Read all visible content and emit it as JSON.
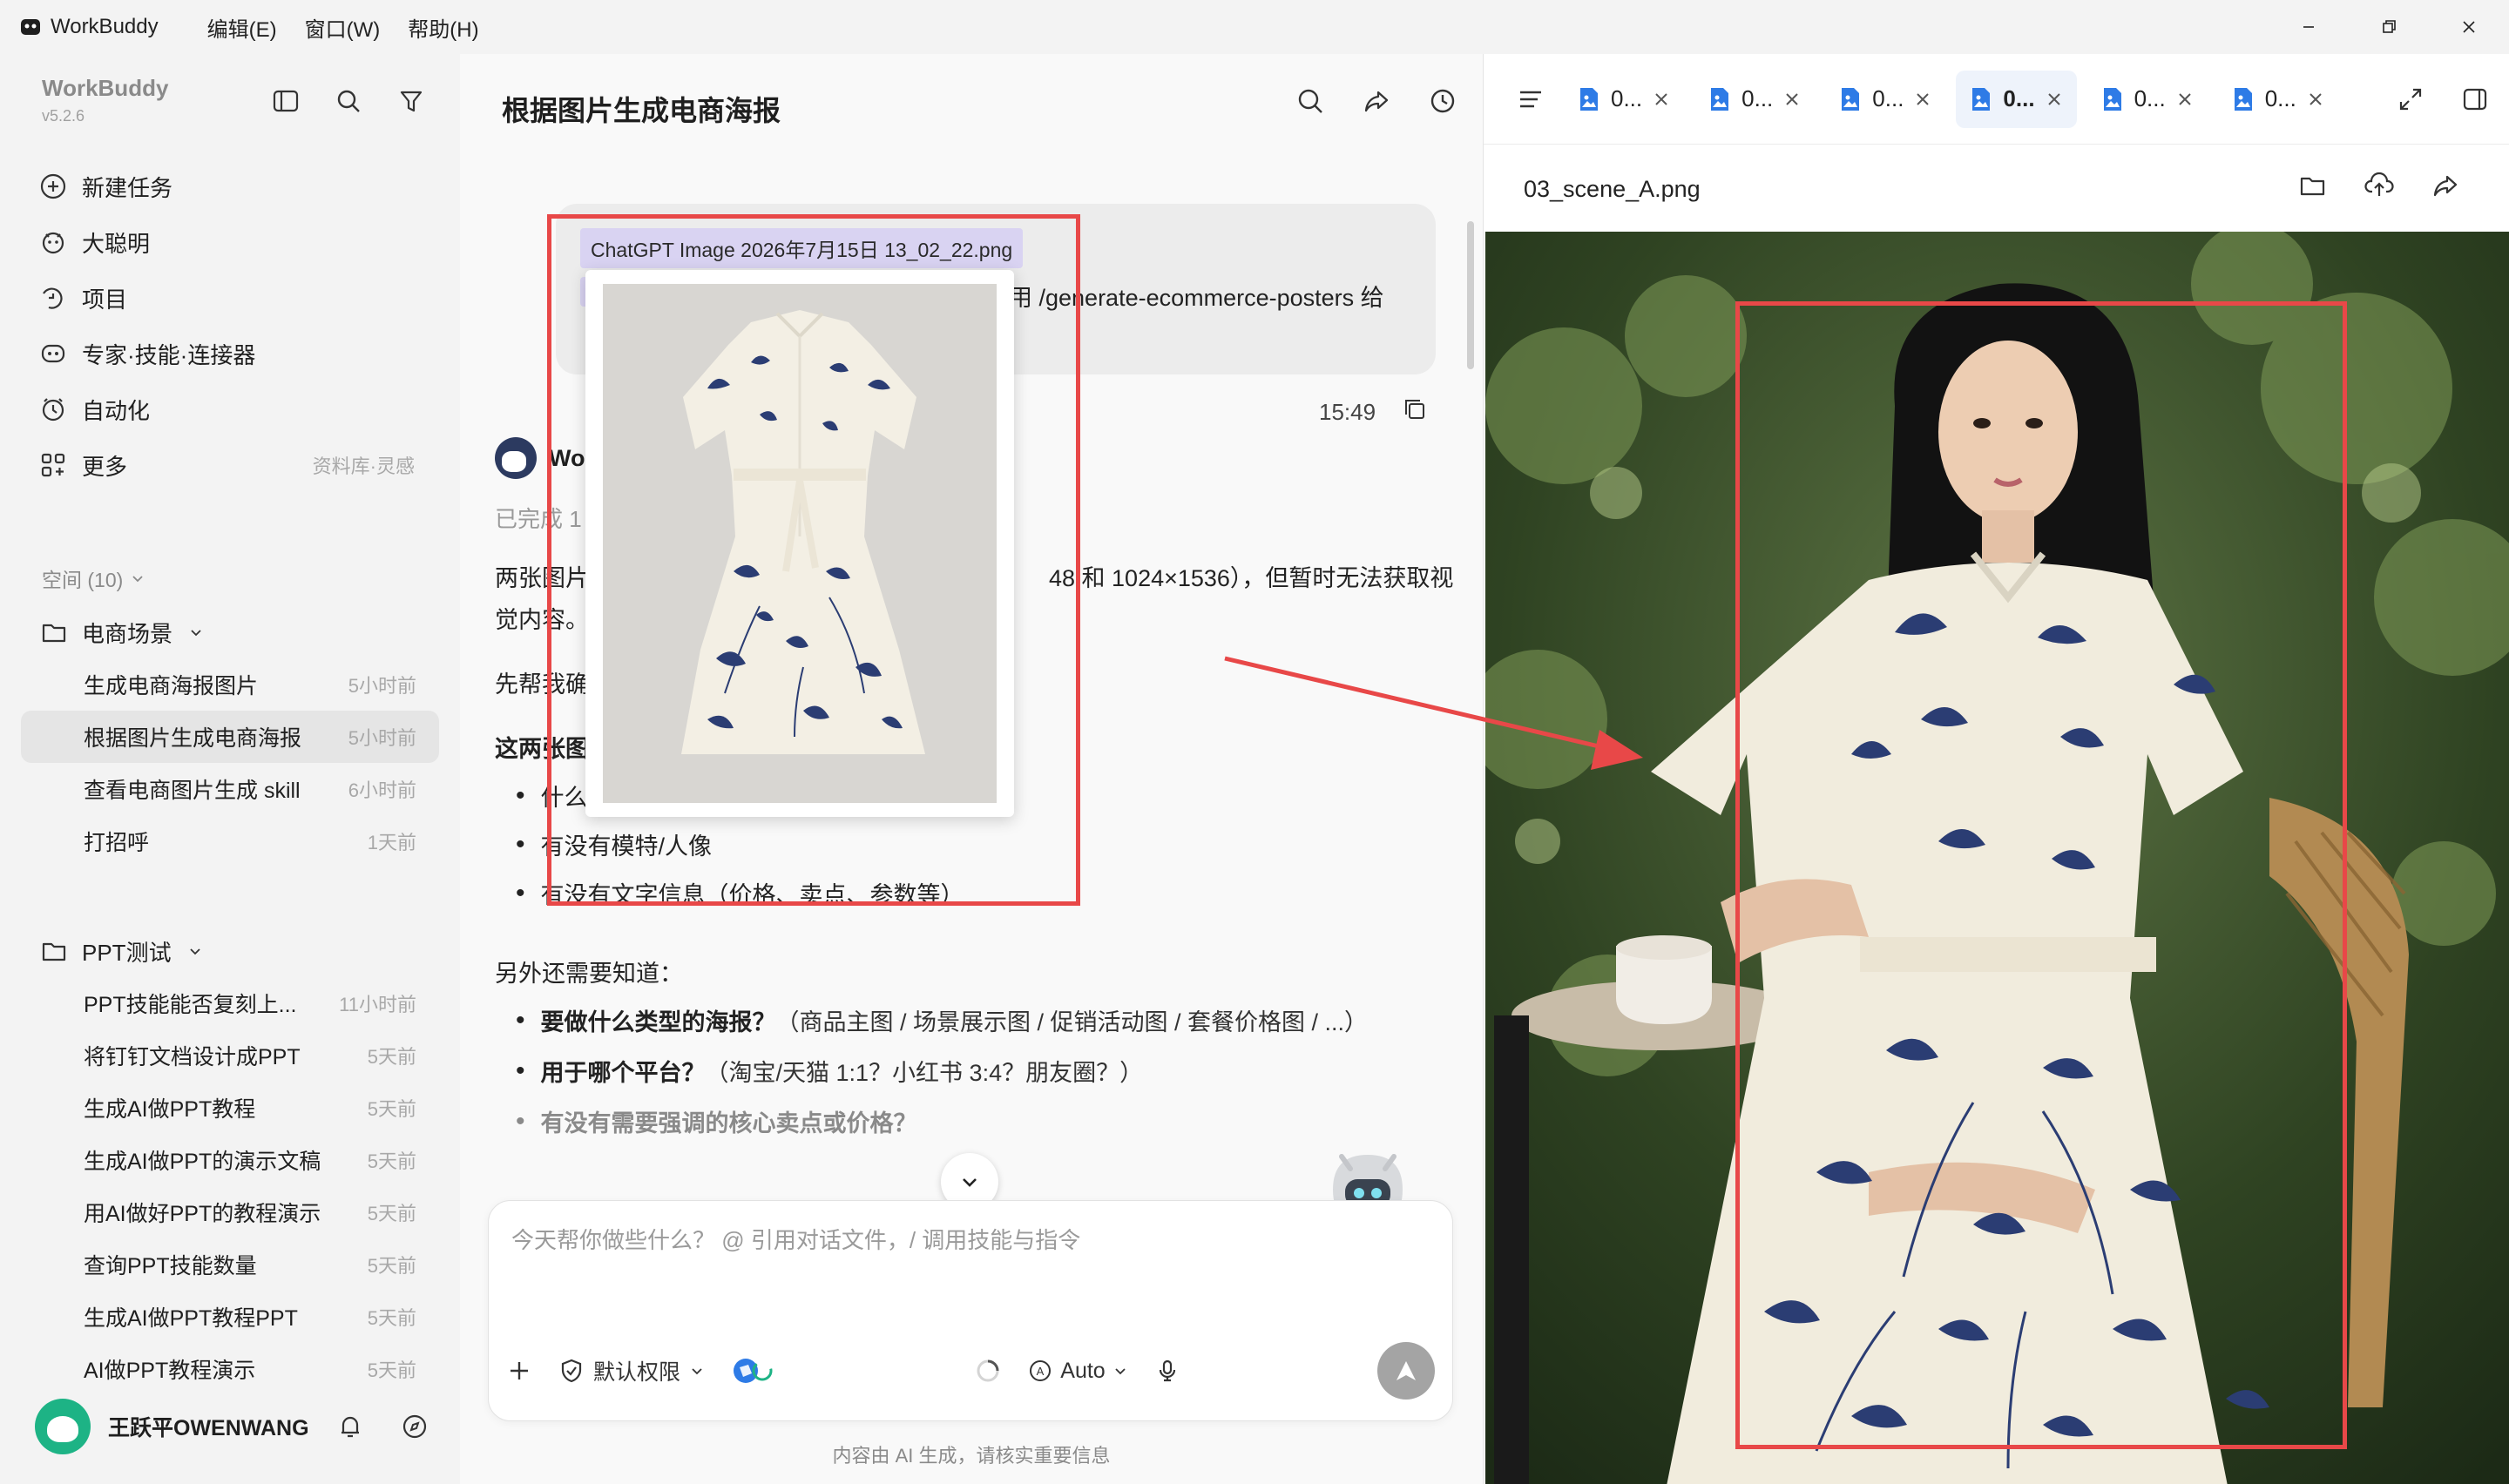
{
  "titlebar": {
    "app_name": "WorkBuddy",
    "menus": [
      "编辑(E)",
      "窗口(W)",
      "帮助(H)"
    ]
  },
  "sidebar": {
    "brand": "WorkBuddy",
    "version": "v5.2.6",
    "nav": [
      {
        "label": "新建任务",
        "icon": "plus-circle-icon"
      },
      {
        "label": "大聪明",
        "icon": "agent-icon"
      },
      {
        "label": "项目",
        "icon": "project-icon"
      },
      {
        "label": "专家·技能·连接器",
        "icon": "expert-icon"
      },
      {
        "label": "自动化",
        "icon": "automation-icon"
      },
      {
        "label": "更多",
        "icon": "more-icon",
        "hint": "资料库·灵感"
      }
    ],
    "space_label": "空间 (10)",
    "groups": [
      {
        "name": "电商场景",
        "threads": [
          {
            "title": "生成电商海报图片",
            "time": "5小时前"
          },
          {
            "title": "根据图片生成电商海报",
            "time": "5小时前",
            "active": true
          },
          {
            "title": "查看电商图片生成 skill",
            "time": "6小时前"
          },
          {
            "title": "打招呼",
            "time": "1天前"
          }
        ]
      },
      {
        "name": "PPT测试",
        "threads": [
          {
            "title": "PPT技能能否复刻上...",
            "time": "11小时前"
          },
          {
            "title": "将钉钉文档设计成PPT",
            "time": "5天前"
          },
          {
            "title": "生成AI做PPT教程",
            "time": "5天前"
          },
          {
            "title": "生成AI做PPT的演示文稿",
            "time": "5天前"
          },
          {
            "title": "用AI做好PPT的教程演示",
            "time": "5天前"
          },
          {
            "title": "查询PPT技能数量",
            "time": "5天前"
          },
          {
            "title": "生成AI做PPT教程PPT",
            "time": "5天前"
          },
          {
            "title": "AI做PPT教程演示",
            "time": "5天前"
          }
        ]
      }
    ],
    "user_name": "王跃平OWENWANG"
  },
  "chat": {
    "title": "根据图片生成电商海报",
    "attachment_name": "ChatGPT Image 2026年7月15日 13_02_22.png",
    "bubble_text_visible": "用 /generate-ecommerce-posters 给",
    "bubble_time": "15:49",
    "bot_name": "Wo",
    "done_line": "已完成 1",
    "paragraph1_a": "两张图片",
    "paragraph1_b": "48 和 1024×1536），但暂时无法获取视",
    "paragraph1_c": "觉内容。",
    "paragraph2": "先帮我确",
    "heading": "这两张图",
    "bullets1": [
      "什么",
      "有没有模特/人像",
      "有没有文字信息（价格、卖点、参数等）"
    ],
    "also_need": "另外还需要知道：",
    "bullets2": [
      {
        "bold": "要做什么类型的海报？",
        "rest": "（商品主图 / 场景展示图 / 促销活动图 / 套餐价格图 / ...）"
      },
      {
        "bold": "用于哪个平台？",
        "rest": "（淘宝/天猫 1:1？小红书 3:4？朋友圈？）"
      },
      {
        "bold": "有没有需要强调的核心卖点或价格？",
        "rest": ""
      }
    ],
    "composer_placeholder": "今天帮你做些什么？ @ 引用对话文件，/ 调用技能与指令",
    "permission_label": "默认权限",
    "model_label": "Auto",
    "disclaimer": "内容由 AI 生成，请核实重要信息"
  },
  "right_panel": {
    "tabs": [
      {
        "label": "0..."
      },
      {
        "label": "0..."
      },
      {
        "label": "0..."
      },
      {
        "label": "0...",
        "active": true
      },
      {
        "label": "0..."
      },
      {
        "label": "0..."
      }
    ],
    "file_name": "03_scene_A.png"
  },
  "colors": {
    "annotation_red": "#e84848",
    "chip_purple": "#d9d3f2",
    "dress_blue": "#2b3d73"
  }
}
